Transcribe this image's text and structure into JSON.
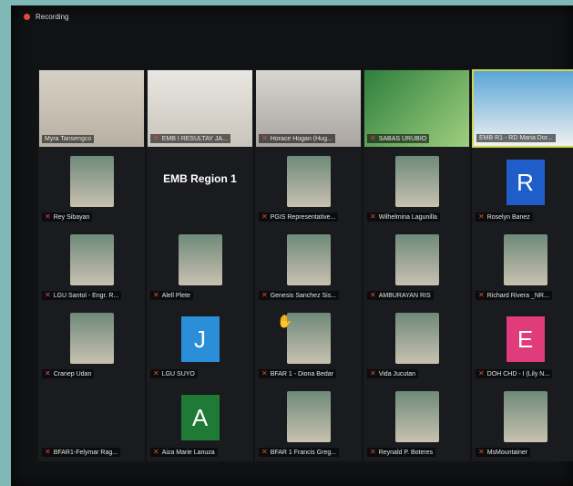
{
  "recording": {
    "label": "Recording"
  },
  "participants": [
    {
      "name": "Myra Tansengco",
      "kind": "video",
      "mic_muted": false
    },
    {
      "name": "EMB I RESULTAY JA...",
      "kind": "video",
      "mic_muted": true
    },
    {
      "name": "Horace Hogan (Hug...",
      "kind": "video",
      "mic_muted": true
    },
    {
      "name": "SABAS URUBIO",
      "kind": "video",
      "mic_muted": true
    },
    {
      "name": "EMB R1 - RD Maria Dor...",
      "kind": "video",
      "mic_muted": false,
      "active": true
    },
    {
      "name": "Rey Sibayan",
      "kind": "photo",
      "mic_muted": true
    },
    {
      "name": "",
      "kind": "text",
      "text": "EMB Region 1",
      "mic_muted": true
    },
    {
      "name": "PGIS Representative...",
      "kind": "photo",
      "mic_muted": true
    },
    {
      "name": "Wilhelmina Lagunilla",
      "kind": "photo",
      "mic_muted": true
    },
    {
      "name": "Roselyn Banez",
      "kind": "letter",
      "letter": "R",
      "color": "#1f5ec8",
      "mic_muted": true
    },
    {
      "name": "LGU Santol - Engr. R...",
      "kind": "photo",
      "mic_muted": true
    },
    {
      "name": "Alell Plete",
      "kind": "photo",
      "mic_muted": true
    },
    {
      "name": "Genesis Sanchez Sis...",
      "kind": "photo",
      "mic_muted": true
    },
    {
      "name": "AMBURAYAN RIS",
      "kind": "photo",
      "mic_muted": true
    },
    {
      "name": "Richard Rivera _NR...",
      "kind": "photo",
      "mic_muted": true
    },
    {
      "name": "Cranep Udan",
      "kind": "photo",
      "mic_muted": true
    },
    {
      "name": "LGU SUYO",
      "kind": "letter",
      "letter": "J",
      "color": "#2a8fd8",
      "mic_muted": true
    },
    {
      "name": "BFAR 1 - Diona Bedar",
      "kind": "photo",
      "mic_muted": true
    },
    {
      "name": "Vida Jucutan",
      "kind": "photo",
      "mic_muted": true
    },
    {
      "name": "DOH CHD - I (Lily N...",
      "kind": "letter",
      "letter": "E",
      "color": "#e03b7a",
      "mic_muted": true
    },
    {
      "name": "BFAR1-Felymar Rag...",
      "kind": "blank",
      "mic_muted": true
    },
    {
      "name": "Aiza Marie Lanuza",
      "kind": "letter",
      "letter": "A",
      "color": "#1e7a34",
      "mic_muted": true
    },
    {
      "name": "BFAR 1 Francis Greg...",
      "kind": "photo",
      "mic_muted": true
    },
    {
      "name": "Reynald P. Boteres",
      "kind": "photo",
      "mic_muted": true
    },
    {
      "name": "MsMountainer",
      "kind": "photo",
      "mic_muted": true
    }
  ],
  "icons": {
    "mic": "muted-mic-icon",
    "cursor": "hand-cursor-icon"
  }
}
